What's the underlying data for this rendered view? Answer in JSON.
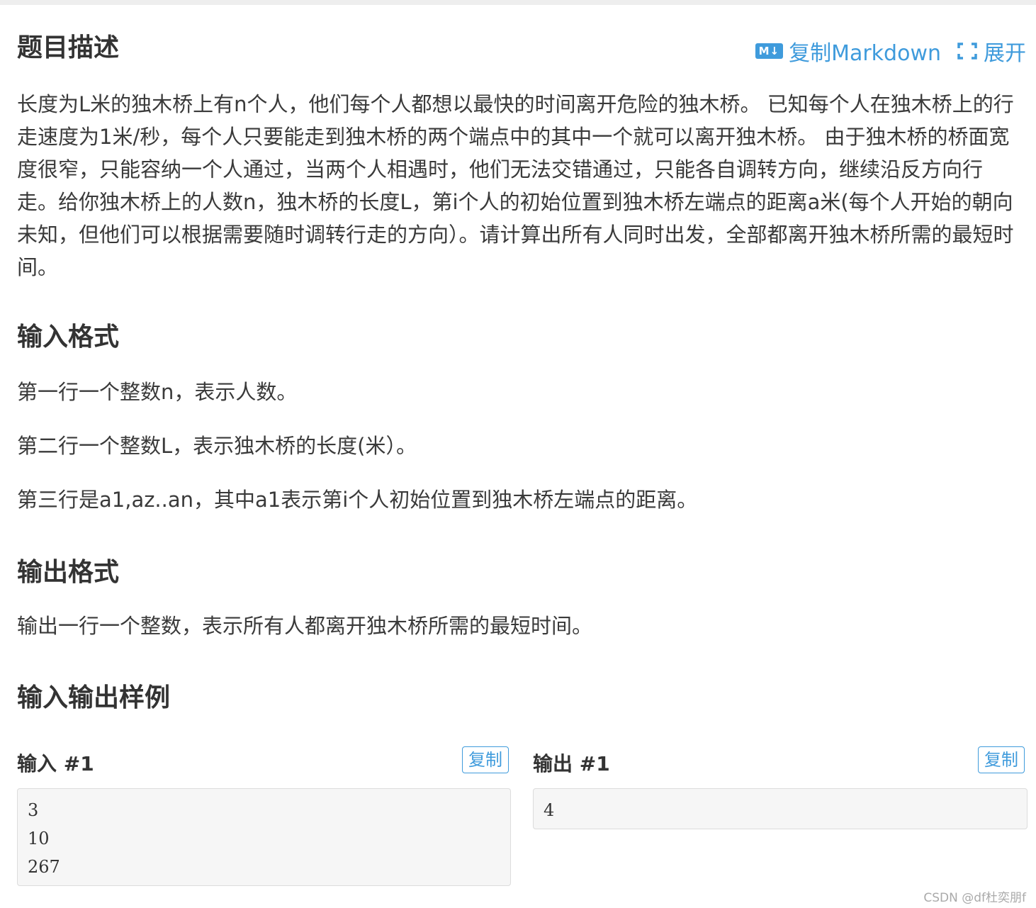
{
  "sections": {
    "description_title": "题目描述",
    "input_title": "输入格式",
    "output_title": "输出格式",
    "sample_title": "输入输出样例"
  },
  "toolbar": {
    "md_icon_text": "M↓",
    "copy_markdown_label": "复制Markdown",
    "expand_label": "展开",
    "icons": [
      "markdown-icon",
      "expand-icon"
    ],
    "accent_color": "#3f9bdc"
  },
  "description": "长度为L米的独木桥上有n个人，他们每个人都想以最快的时间离开危险的独木桥。 已知每个人在独木桥上的行走速度为1米/秒，每个人只要能走到独木桥的两个端点中的其中一个就可以离开独木桥。 由于独木桥的桥面宽度很窄，只能容纳一个人通过，当两个人相遇时，他们无法交错通过，只能各自调转方向，继续沿反方向行走。给你独木桥上的人数n，独木桥的长度L，第i个人的初始位置到独木桥左端点的距离a米(每个人开始的朝向未知，但他们可以根据需要随时调转行走的方向）。请计算出所有人同时出发，全部都离开独木桥所需的最短时间。",
  "input_format": [
    "第一行一个整数n，表示人数。",
    "第二行一个整数L，表示独木桥的长度(米）。",
    "第三行是a1,az..an，其中a1表示第i个人初始位置到独木桥左端点的距离。"
  ],
  "output_format": [
    "输出一行一个整数，表示所有人都离开独木桥所需的最短时间。"
  ],
  "samples": [
    {
      "input_title": "输入 #1",
      "output_title": "输出 #1",
      "copy_label": "复制",
      "input_lines": [
        "3",
        "10",
        "267"
      ],
      "output_lines": [
        "4"
      ]
    }
  ],
  "watermark": "CSDN @df杜奕朋f"
}
